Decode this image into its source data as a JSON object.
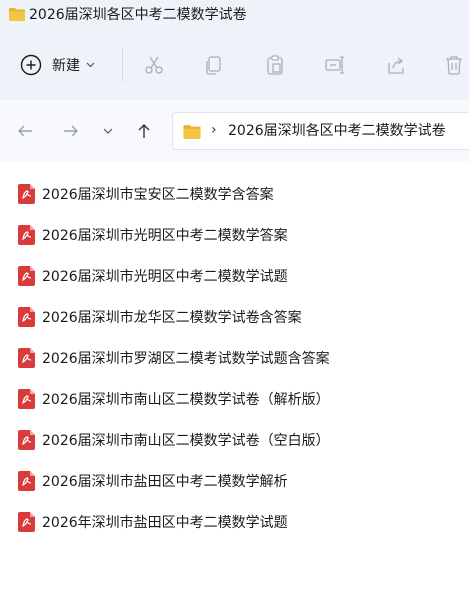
{
  "window": {
    "title": "2026届深圳各区中考二模数学试卷"
  },
  "toolbar": {
    "new_label": "新建",
    "icons": [
      "cut-icon",
      "copy-icon",
      "paste-icon",
      "rename-icon",
      "share-icon",
      "delete-icon"
    ]
  },
  "address": {
    "path": "2026届深圳各区中考二模数学试卷"
  },
  "colors": {
    "folder": "#f4c542",
    "pdf_red": "#d93b3b",
    "chrome_bg": "#eef3f9",
    "nav_bg": "#f7f9fc"
  },
  "files": [
    {
      "name": "2026届深圳市宝安区二模数学含答案"
    },
    {
      "name": "2026届深圳市光明区中考二模数学答案"
    },
    {
      "name": "2026届深圳市光明区中考二模数学试题"
    },
    {
      "name": "2026届深圳市龙华区二模数学试卷含答案"
    },
    {
      "name": "2026届深圳市罗湖区二模考试数学试题含答案"
    },
    {
      "name": "2026届深圳市南山区二模数学试卷（解析版）"
    },
    {
      "name": "2026届深圳市南山区二模数学试卷（空白版）"
    },
    {
      "name": "2026届深圳市盐田区中考二模数学解析"
    },
    {
      "name": "2026年深圳市盐田区中考二模数学试题"
    }
  ]
}
